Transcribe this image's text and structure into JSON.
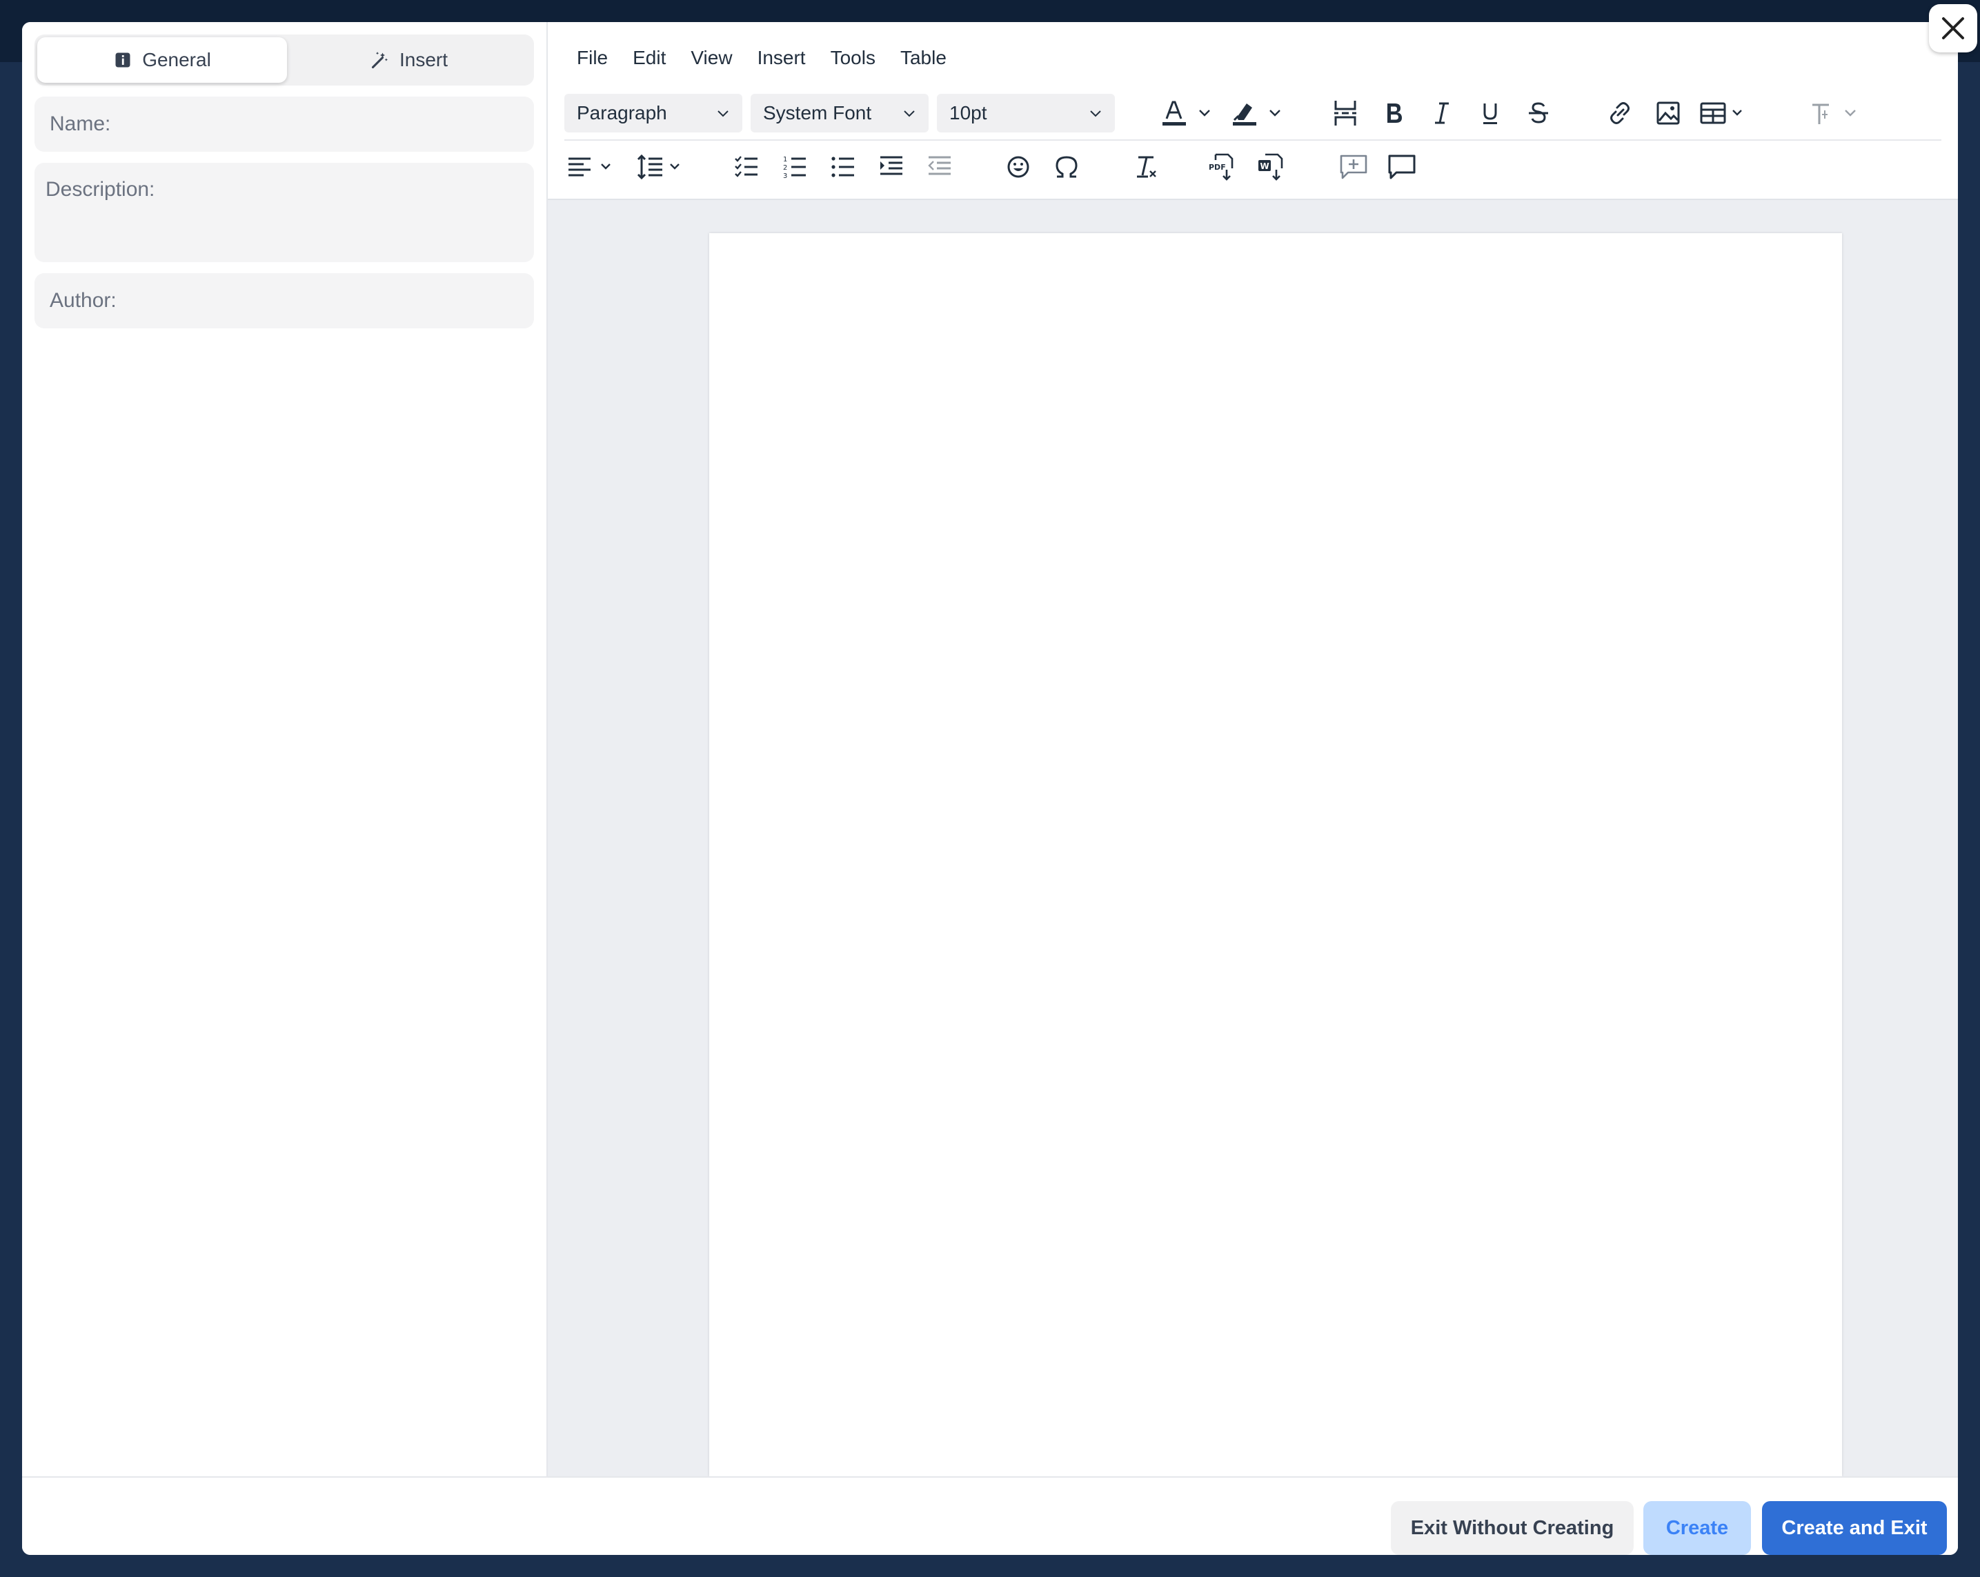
{
  "left_panel": {
    "tabs": [
      {
        "label": "General",
        "icon": "info-icon",
        "active": true
      },
      {
        "label": "Insert",
        "icon": "magic-wand-icon",
        "active": false
      }
    ],
    "fields": {
      "name_placeholder": "Name:",
      "description_placeholder": "Description:",
      "author_placeholder": "Author:"
    }
  },
  "editor": {
    "menu": [
      "File",
      "Edit",
      "View",
      "Insert",
      "Tools",
      "Table"
    ],
    "block_format": "Paragraph",
    "font_family": "System Font",
    "font_size": "10pt",
    "icons_row1": [
      "text-color-icon",
      "highlight-color-icon",
      "page-break-icon",
      "bold-icon",
      "italic-icon",
      "underline-icon",
      "strikethrough-icon",
      "link-icon",
      "image-icon",
      "table-icon",
      "text-direction-icon"
    ],
    "icons_row2": [
      "align-left-icon",
      "line-height-icon",
      "checklist-icon",
      "numbered-list-icon",
      "bullet-list-icon",
      "indent-icon",
      "outdent-icon",
      "emoji-icon",
      "special-char-icon",
      "clear-format-icon",
      "export-pdf-icon",
      "export-word-icon",
      "add-comment-icon",
      "comments-icon"
    ]
  },
  "footer": {
    "exit_label": "Exit Without Creating",
    "create_label": "Create",
    "create_exit_label": "Create and Exit"
  },
  "colors": {
    "primary": "#2f6fd6",
    "create_disabled_bg": "#bfdbfe",
    "backdrop": "#1a2f4d"
  }
}
